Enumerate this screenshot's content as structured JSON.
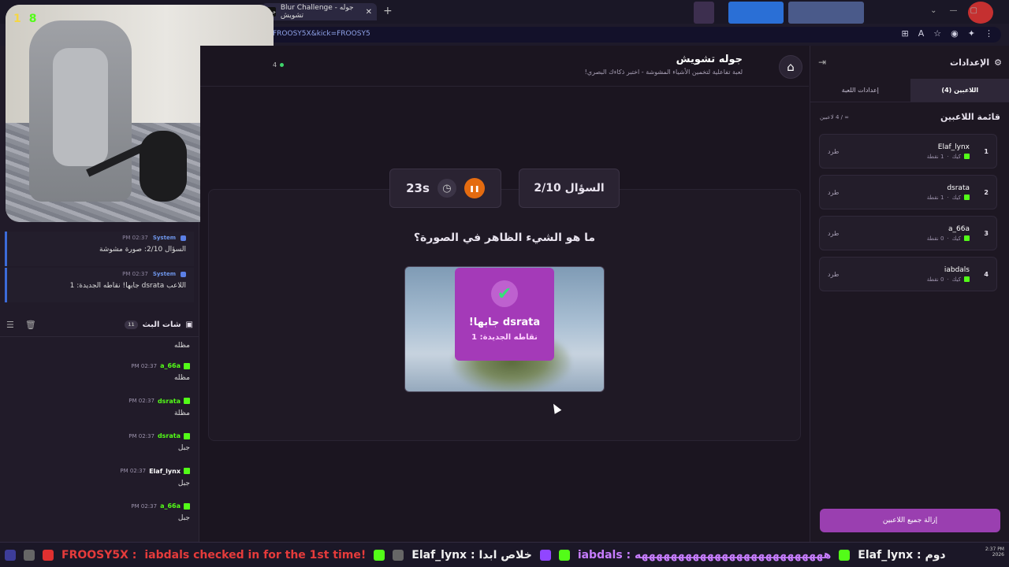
{
  "browser": {
    "tab_title": "Blur Challenge - جوله تشويش",
    "tab_favicon": "جوله",
    "new_tab": "+",
    "url": "FROOSY5X&kick=FROOSY5"
  },
  "webcam": {
    "num1": "1",
    "num2": "8"
  },
  "system_messages": [
    {
      "user": "System",
      "time": "PM 02:37",
      "text": "السؤال 2/10: صورة مشوشة"
    },
    {
      "user": "System",
      "time": "PM 02:37",
      "text": "اللاعب dsrata جابها! نقاطه الجديدة: 1"
    }
  ],
  "chat": {
    "title": "شات البث",
    "count": "11",
    "messages": [
      {
        "user": "",
        "time": "",
        "text": "مظله",
        "color": "#53fc18"
      },
      {
        "user": "a_66a",
        "time": "PM 02:37",
        "text": "مظله",
        "color": "#53fc18"
      },
      {
        "user": "dsrata",
        "time": "PM 02:37",
        "text": "مظلة",
        "color": "#53fc18"
      },
      {
        "user": "dsrata",
        "time": "PM 02:37",
        "text": "جبل",
        "color": "#53fc18"
      },
      {
        "user": "Elaf_lynx",
        "time": "PM 02:37",
        "text": "جبل",
        "color": "#ffffff"
      },
      {
        "user": "a_66a",
        "time": "PM 02:37",
        "text": "جبل",
        "color": "#53fc18"
      }
    ]
  },
  "header": {
    "title": "جوله تشويش",
    "subtitle": "لعبة تفاعلية لتخمين الأشياء المشوشة - اختبر ذكاءك البصري!",
    "online_count": "4"
  },
  "game": {
    "question_counter": "السؤال 2/10",
    "timer": "23s",
    "question": "ما هو الشيء الظاهر في الصورة؟",
    "result_line1": "dsrata جابها!",
    "result_line2": "نقاطه الجديدة: 1"
  },
  "panel": {
    "title": "الإعدادات",
    "tabs": [
      {
        "label": "اللاعبين (4)",
        "active": true
      },
      {
        "label": "إعدادات اللعبة",
        "active": false
      }
    ],
    "players_title": "قائمة اللاعبين",
    "players_count": "∞ / 4 لاعبين",
    "players": [
      {
        "rank": "1",
        "name": "Elaf_lynx",
        "platform": "كيك",
        "points": "1 نقطة",
        "kick_label": "طرد"
      },
      {
        "rank": "2",
        "name": "dsrata",
        "platform": "كيك",
        "points": "1 نقطة",
        "kick_label": "طرد"
      },
      {
        "rank": "3",
        "name": "a_66a",
        "platform": "كيك",
        "points": "0 نقطة",
        "kick_label": "طرد"
      },
      {
        "rank": "4",
        "name": "iabdals",
        "platform": "كيك",
        "points": "0 نقطة",
        "kick_label": "طرد"
      }
    ],
    "remove_all": "إزالة جميع اللاعبين"
  },
  "ticker": {
    "item1_user": "FROOSY5X :",
    "item1_text": "iabdals checked in for the 1st time!",
    "item2": "Elaf_lynx : خلاص ابدا",
    "item3": "iabdals : ههههههههههههههههههههههههههه",
    "item4": "Elaf_lynx : دوم",
    "clock_time": "2:37 PM",
    "clock_date": "2026"
  },
  "colors": {
    "accent_purple": "#a43ab8",
    "kick_green": "#53fc18",
    "timer_orange": "#e46b10",
    "system_blue": "#3c6bd9"
  }
}
